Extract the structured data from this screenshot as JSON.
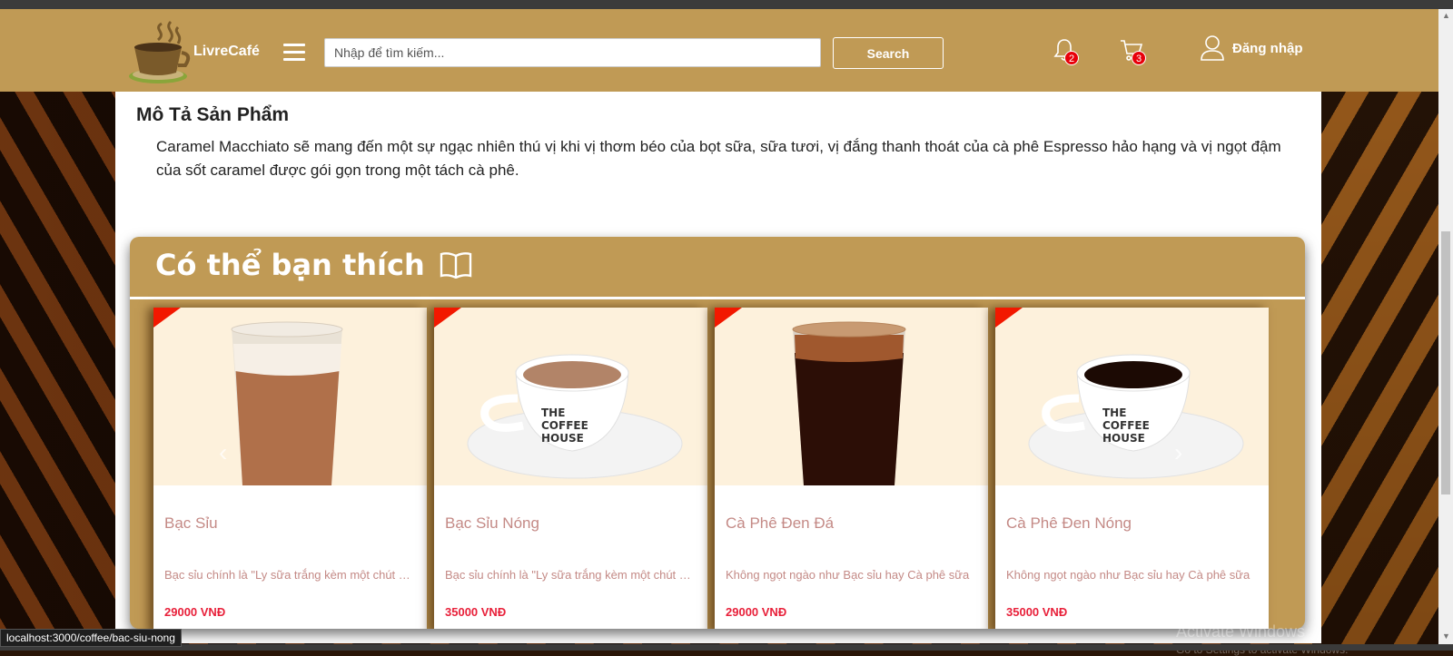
{
  "header": {
    "brand": "LivreCafé",
    "search_placeholder": "Nhập để tìm kiếm...",
    "search_label": "Search",
    "notification_count": "2",
    "cart_count": "3",
    "login_label": "Đăng nhập"
  },
  "description": {
    "title": "Mô Tả Sản Phẩm",
    "text": "Caramel Macchiato sẽ mang đến một sự ngạc nhiên thú vị khi vị thơm béo của bọt sữa, sữa tươi, vị đắng thanh thoát của cà phê Espresso hảo hạng và vị ngọt đậm của sốt caramel được gói gọn trong một tách cà phê."
  },
  "suggestions": {
    "title": "Có thể bạn thích",
    "prev_icon": "chevron-left-icon",
    "next_icon": "chevron-right-icon",
    "items": [
      {
        "name": "Bạc Sỉu",
        "desc": "Bạc sỉu chính là \"Ly sữa trắng kèm một chút cà phê\"",
        "price": "29000 VNĐ",
        "image": "iced-milk-coffee-glass"
      },
      {
        "name": "Bạc Sỉu Nóng",
        "desc": "Bạc sỉu chính là \"Ly sữa trắng kèm một chút cà phê\"",
        "price": "35000 VNĐ",
        "image": "hot-latte-cup"
      },
      {
        "name": "Cà Phê Đen Đá",
        "desc": "Không ngọt ngào như Bạc sỉu hay Cà phê sữa",
        "price": "29000 VNĐ",
        "image": "iced-black-coffee-glass"
      },
      {
        "name": "Cà Phê Đen Nóng",
        "desc": "Không ngọt ngào như Bạc sỉu hay Cà phê sữa",
        "price": "35000 VNĐ",
        "image": "hot-black-coffee-cup"
      }
    ]
  },
  "status_bar": {
    "url": "localhost:3000/coffee/bac-siu-nong"
  },
  "os_watermark": {
    "line1": "Activate Windows",
    "line2": "Go to Settings to activate Windows."
  },
  "colors": {
    "header_bg": "#c09a55",
    "badge": "#e8000a",
    "price": "#e8203a",
    "product_name": "#c48a86"
  }
}
